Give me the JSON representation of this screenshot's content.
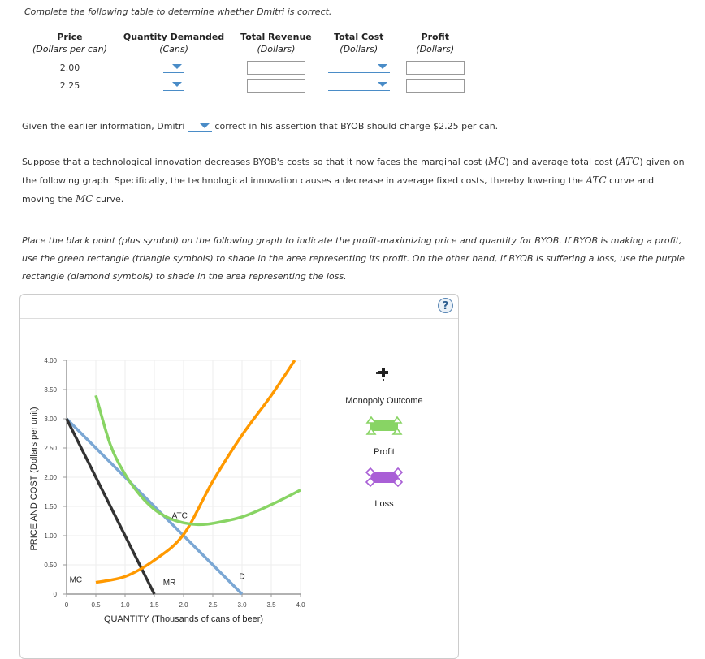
{
  "intro": "Complete the following table to determine whether Dmitri is correct.",
  "table": {
    "headers": [
      {
        "title": "Price",
        "unit": "(Dollars per can)"
      },
      {
        "title": "Quantity Demanded",
        "unit": "(Cans)"
      },
      {
        "title": "Total Revenue",
        "unit": "(Dollars)"
      },
      {
        "title": "Total Cost",
        "unit": "(Dollars)"
      },
      {
        "title": "Profit",
        "unit": "(Dollars)"
      }
    ],
    "rows": [
      {
        "price": "2.00",
        "quantity_demanded": "",
        "total_revenue": "",
        "total_cost": "",
        "profit": ""
      },
      {
        "price": "2.25",
        "quantity_demanded": "",
        "total_revenue": "",
        "total_cost": "",
        "profit": ""
      }
    ]
  },
  "assertion": {
    "before": "Given the earlier information, Dmitri",
    "dropdown_value": "",
    "after": "correct in his assertion that BYOB should charge $2.25 per can."
  },
  "innovation_paragraph": {
    "p1": "Suppose that a technological innovation decreases BYOB's costs so that it now faces the marginal cost (",
    "mc": "MC",
    "p2": ") and average total cost (",
    "atc": "ATC",
    "p3": ") given on the following graph. Specifically, the technological innovation causes a decrease in average fixed costs, thereby lowering the ",
    "p4": " curve and moving the ",
    "p5": " curve."
  },
  "instructions": "Place the black point (plus symbol) on the following graph to indicate the profit-maximizing price and quantity for BYOB. If BYOB is making a profit, use the green rectangle (triangle symbols) to shade in the area representing its profit. On the other hand, if BYOB is suffering a loss, use the purple rectangle (diamond symbols) to shade in the area representing the loss.",
  "help_label": "?",
  "legend": {
    "monopoly_outcome": "Monopoly Outcome",
    "profit": "Profit",
    "loss": "Loss"
  },
  "colors": {
    "demand": "#7ba7d4",
    "mr": "#333333",
    "mc": "#ff9900",
    "atc": "#88d464",
    "profit": "#88d464",
    "loss": "#a95fd6",
    "accent": "#4a8cc7"
  },
  "chart_data": {
    "type": "line",
    "xlabel": "QUANTITY (Thousands of cans of beer)",
    "ylabel": "PRICE AND COST (Dollars per unit)",
    "xlim": [
      0,
      4.0
    ],
    "ylim": [
      0,
      4.0
    ],
    "x_ticks": [
      "0",
      "0.5",
      "1.0",
      "1.5",
      "2.0",
      "2.5",
      "3.0",
      "3.5",
      "4.0"
    ],
    "y_ticks": [
      "0",
      "0.50",
      "1.00",
      "1.50",
      "2.00",
      "2.50",
      "3.00",
      "3.50",
      "4.00"
    ],
    "grid": true,
    "series": [
      {
        "name": "D",
        "label": "D",
        "points": [
          [
            0,
            3.0
          ],
          [
            3.0,
            0
          ]
        ]
      },
      {
        "name": "MR",
        "label": "MR",
        "points": [
          [
            0,
            3.0
          ],
          [
            1.5,
            0
          ]
        ]
      },
      {
        "name": "MC",
        "label": "MC",
        "points": [
          [
            0.5,
            0.2
          ],
          [
            1.0,
            0.3
          ],
          [
            1.5,
            0.58
          ],
          [
            2.0,
            1.02
          ],
          [
            2.5,
            1.93
          ],
          [
            3.0,
            2.72
          ],
          [
            3.5,
            3.4
          ],
          [
            3.9,
            4.0
          ]
        ]
      },
      {
        "name": "ATC",
        "label": "ATC",
        "points": [
          [
            0.5,
            3.4
          ],
          [
            0.75,
            2.55
          ],
          [
            1.0,
            2.05
          ],
          [
            1.25,
            1.7
          ],
          [
            1.5,
            1.45
          ],
          [
            1.75,
            1.3
          ],
          [
            2.0,
            1.22
          ],
          [
            2.25,
            1.19
          ],
          [
            2.5,
            1.21
          ],
          [
            3.0,
            1.32
          ],
          [
            3.5,
            1.53
          ],
          [
            4.0,
            1.78
          ]
        ]
      }
    ]
  }
}
